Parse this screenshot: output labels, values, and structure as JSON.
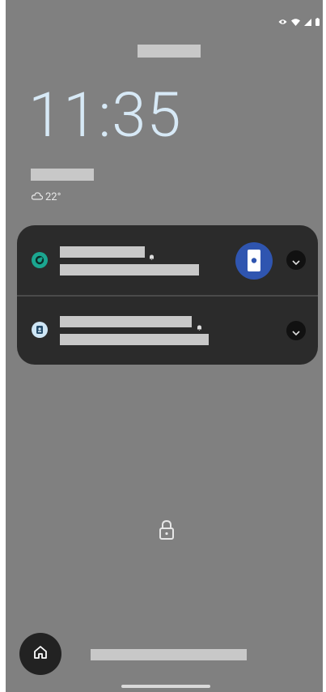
{
  "status_bar": {
    "icons": [
      "eye-icon",
      "wifi-icon",
      "cellular-signal-icon",
      "battery-icon"
    ]
  },
  "lockscreen": {
    "time": "11:35",
    "weather": {
      "icon": "cloud-icon",
      "temperature": "22°"
    }
  },
  "notifications": [
    {
      "app_icon": "green-app-icon",
      "title": "",
      "text": "",
      "has_bell": true,
      "has_thumbnail": true,
      "expand_icon": "chevron-down-icon"
    },
    {
      "app_icon": "contact-app-icon",
      "title": "",
      "text": "",
      "has_bell": true,
      "has_thumbnail": false,
      "expand_icon": "chevron-down-icon"
    }
  ],
  "bottom": {
    "lock_icon": "padlock-icon",
    "home_icon": "home-icon"
  },
  "colors": {
    "background": "#808080",
    "notification_card": "#2b2b2b",
    "clock": "#d7e9f6",
    "accent_green": "#1ba690",
    "thumbnail_blue": "#2f55b0"
  }
}
